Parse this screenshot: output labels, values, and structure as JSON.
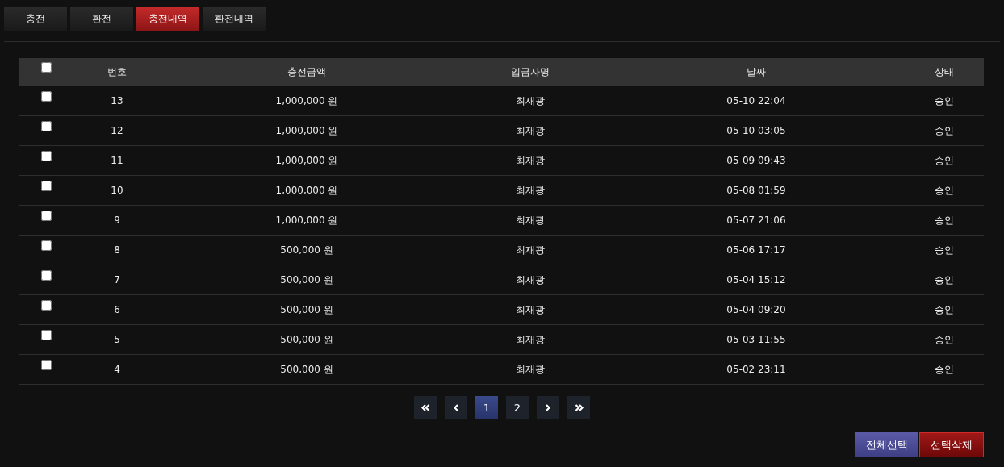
{
  "tabs": [
    {
      "label": "충전",
      "selected": false
    },
    {
      "label": "환전",
      "selected": false
    },
    {
      "label": "충전내역",
      "selected": true
    },
    {
      "label": "환전내역",
      "selected": false
    }
  ],
  "table": {
    "select_all_checked": false,
    "columns": [
      "번호",
      "충전금액",
      "입금자명",
      "날짜",
      "상태"
    ],
    "rows": [
      {
        "checked": false,
        "cells": [
          "13",
          "1,000,000 원",
          "최재광",
          "05-10 22:04",
          "승인"
        ]
      },
      {
        "checked": false,
        "cells": [
          "12",
          "1,000,000 원",
          "최재광",
          "05-10 03:05",
          "승인"
        ]
      },
      {
        "checked": false,
        "cells": [
          "11",
          "1,000,000 원",
          "최재광",
          "05-09 09:43",
          "승인"
        ]
      },
      {
        "checked": false,
        "cells": [
          "10",
          "1,000,000 원",
          "최재광",
          "05-08 01:59",
          "승인"
        ]
      },
      {
        "checked": false,
        "cells": [
          "9",
          "1,000,000 원",
          "최재광",
          "05-07 21:06",
          "승인"
        ]
      },
      {
        "checked": false,
        "cells": [
          "8",
          "500,000 원",
          "최재광",
          "05-06 17:17",
          "승인"
        ]
      },
      {
        "checked": false,
        "cells": [
          "7",
          "500,000 원",
          "최재광",
          "05-04 15:12",
          "승인"
        ]
      },
      {
        "checked": false,
        "cells": [
          "6",
          "500,000 원",
          "최재광",
          "05-04 09:20",
          "승인"
        ]
      },
      {
        "checked": false,
        "cells": [
          "5",
          "500,000 원",
          "최재광",
          "05-03 11:55",
          "승인"
        ]
      },
      {
        "checked": false,
        "cells": [
          "4",
          "500,000 원",
          "최재광",
          "05-02 23:11",
          "승인"
        ]
      }
    ]
  },
  "pagination": {
    "pages": [
      {
        "label": "1",
        "selected": true
      },
      {
        "label": "2",
        "selected": false
      }
    ]
  },
  "buttons": [
    {
      "label": "전체선택",
      "kind": "select"
    },
    {
      "label": "선택삭제",
      "kind": "delete"
    }
  ]
}
